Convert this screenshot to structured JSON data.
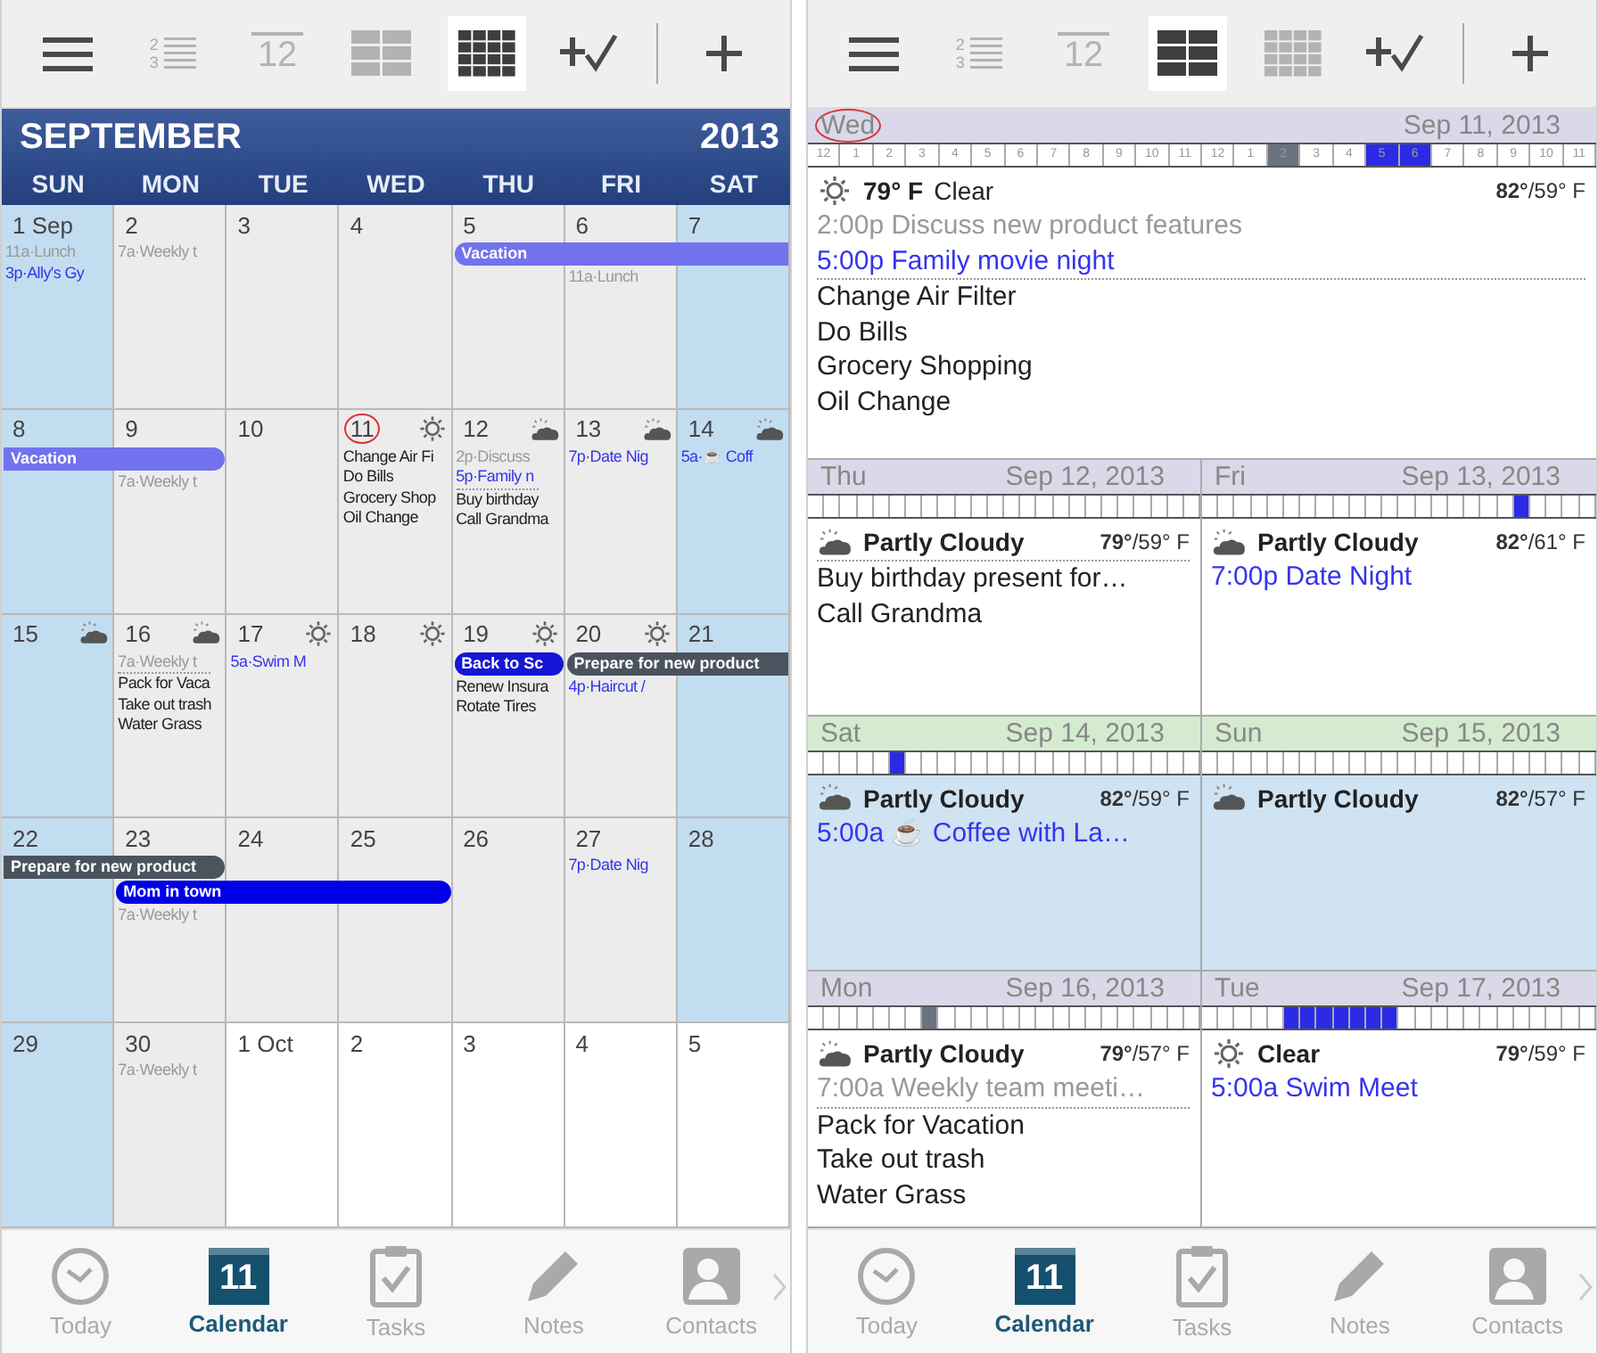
{
  "screens": [
    {
      "kind": "month",
      "toolbar": [
        {
          "kind": "menu",
          "selected": false
        },
        {
          "kind": "list",
          "selected": false,
          "digits": [
            "2",
            "3"
          ]
        },
        {
          "kind": "day",
          "selected": false,
          "text": "12"
        },
        {
          "kind": "week",
          "selected": false
        },
        {
          "kind": "month",
          "selected": true
        },
        {
          "kind": "add_task",
          "selected": false
        },
        {
          "kind": "add",
          "selected": false
        }
      ],
      "month": {
        "title": "SEPTEMBER",
        "year": "2013",
        "weekdays": [
          "SUN",
          "MON",
          "TUE",
          "WED",
          "THU",
          "FRI",
          "SAT"
        ],
        "weeks": [
          {
            "cells": [
              {
                "day": "1 Sep",
                "kind": "weekend",
                "today": false,
                "events": [
                  {
                    "text": "11a·Lunch",
                    "kind": "past"
                  },
                  {
                    "text": "3p·Ally's Gy",
                    "kind": "event"
                  }
                ]
              },
              {
                "day": "2",
                "kind": "weekday",
                "today": false,
                "events": [
                  {
                    "text": "7a·Weekly t",
                    "kind": "past"
                  }
                ]
              },
              {
                "day": "3",
                "kind": "weekday",
                "today": false
              },
              {
                "day": "4",
                "kind": "weekday",
                "today": false
              },
              {
                "day": "5",
                "kind": "weekday",
                "today": false,
                "bars": [
                  {
                    "kind": "start",
                    "label": "Vacation",
                    "color": "#7272ee"
                  }
                ]
              },
              {
                "day": "6",
                "kind": "weekday",
                "today": false,
                "bars": [
                  {
                    "kind": "middle"
                  }
                ],
                "events": [
                  {
                    "text": "11a·Lunch",
                    "kind": "past"
                  }
                ]
              },
              {
                "day": "7",
                "kind": "weekend",
                "today": false,
                "bars": [
                  {
                    "kind": "middle"
                  }
                ]
              }
            ]
          },
          {
            "cells": [
              {
                "day": "8",
                "kind": "weekend",
                "today": false,
                "bars": [
                  {
                    "kind": "continue",
                    "label": "Vacation",
                    "color": "#7272ee"
                  }
                ]
              },
              {
                "day": "9",
                "kind": "weekday",
                "today": false,
                "bars": [
                  {
                    "kind": "end"
                  }
                ],
                "events": [
                  {
                    "text": "7a·Weekly t",
                    "kind": "past"
                  }
                ]
              },
              {
                "day": "10",
                "kind": "weekday",
                "today": false
              },
              {
                "day": "11",
                "kind": "weekday",
                "today": true,
                "weather": {
                  "kind": "sun"
                },
                "events": [
                  {
                    "text": "Change Air Fi",
                    "kind": "task"
                  },
                  {
                    "text": "Do Bills",
                    "kind": "task"
                  },
                  {
                    "text": "Grocery Shop",
                    "kind": "task"
                  },
                  {
                    "text": "Oil Change",
                    "kind": "task"
                  }
                ]
              },
              {
                "day": "12",
                "kind": "weekday",
                "today": false,
                "weather": {
                  "kind": "cloudy"
                },
                "events": [
                  {
                    "text": "2p·Discuss",
                    "kind": "past"
                  },
                  {
                    "text": "5p·Family n",
                    "kind": "event"
                  },
                  {
                    "text": "Buy birthday",
                    "kind": "task"
                  },
                  {
                    "text": "Call Grandma",
                    "kind": "task"
                  }
                ]
              },
              {
                "day": "13",
                "kind": "weekday",
                "today": false,
                "weather": {
                  "kind": "cloudy"
                },
                "events": [
                  {
                    "text": "7p·Date Nig",
                    "kind": "event"
                  }
                ]
              },
              {
                "day": "14",
                "kind": "weekend",
                "today": false,
                "weather": {
                  "kind": "cloudy"
                },
                "events": [
                  {
                    "text": "5a·☕ Coff",
                    "kind": "event"
                  }
                ]
              }
            ]
          },
          {
            "cells": [
              {
                "day": "15",
                "kind": "weekend",
                "today": false,
                "weather": {
                  "kind": "cloudy"
                }
              },
              {
                "day": "16",
                "kind": "weekday",
                "today": false,
                "weather": {
                  "kind": "cloudy"
                },
                "events": [
                  {
                    "text": "7a·Weekly t",
                    "kind": "past"
                  },
                  {
                    "text": "Pack for Vaca",
                    "kind": "task"
                  },
                  {
                    "text": "Take out trash",
                    "kind": "task"
                  },
                  {
                    "text": "Water Grass",
                    "kind": "task"
                  }
                ]
              },
              {
                "day": "17",
                "kind": "weekday",
                "today": false,
                "weather": {
                  "kind": "sun"
                },
                "events": [
                  {
                    "text": "5a·Swim M",
                    "kind": "event"
                  }
                ]
              },
              {
                "day": "18",
                "kind": "weekday",
                "today": false,
                "weather": {
                  "kind": "sun"
                }
              },
              {
                "day": "19",
                "kind": "weekday",
                "today": false,
                "weather": {
                  "kind": "sun"
                },
                "bars": [
                  {
                    "kind": "single",
                    "label": "Back to Sc",
                    "color": "#1616d6"
                  }
                ],
                "events": [
                  {
                    "text": "Renew Insura",
                    "kind": "task"
                  },
                  {
                    "text": "Rotate Tires",
                    "kind": "task"
                  }
                ]
              },
              {
                "day": "20",
                "kind": "weekday",
                "today": false,
                "weather": {
                  "kind": "sun"
                },
                "bars": [
                  {
                    "kind": "start",
                    "label": "Prepare for new product",
                    "color": "#4a535e"
                  }
                ],
                "events": [
                  {
                    "text": "4p·Haircut /",
                    "kind": "event"
                  }
                ]
              },
              {
                "day": "21",
                "kind": "weekend",
                "today": false,
                "bars": [
                  {
                    "kind": "middle"
                  }
                ]
              }
            ]
          },
          {
            "cells": [
              {
                "day": "22",
                "kind": "weekend",
                "today": false,
                "bars": [
                  {
                    "kind": "continue",
                    "label": "Prepare for new product",
                    "color": "#4a535e"
                  }
                ]
              },
              {
                "day": "23",
                "kind": "weekday",
                "today": false,
                "bars": [
                  {
                    "kind": "end"
                  },
                  {
                    "kind": "start",
                    "label": "Mom in town",
                    "color": "#0000e8"
                  }
                ],
                "events": [
                  {
                    "text": "7a·Weekly t",
                    "kind": "past"
                  }
                ]
              },
              {
                "day": "24",
                "kind": "weekday",
                "today": false,
                "bars": [
                  {
                    "kind": "none"
                  },
                  {
                    "kind": "middle"
                  }
                ]
              },
              {
                "day": "25",
                "kind": "weekday",
                "today": false,
                "bars": [
                  {
                    "kind": "none"
                  },
                  {
                    "kind": "end"
                  }
                ]
              },
              {
                "day": "26",
                "kind": "weekday",
                "today": false
              },
              {
                "day": "27",
                "kind": "weekday",
                "today": false,
                "events": [
                  {
                    "text": "7p·Date Nig",
                    "kind": "event"
                  }
                ]
              },
              {
                "day": "28",
                "kind": "weekend",
                "today": false
              }
            ]
          },
          {
            "cells": [
              {
                "day": "29",
                "kind": "weekend",
                "today": false
              },
              {
                "day": "30",
                "kind": "weekday",
                "today": false,
                "events": [
                  {
                    "text": "7a·Weekly t",
                    "kind": "past"
                  }
                ]
              },
              {
                "day": "1 Oct",
                "kind": "next_month",
                "today": false
              },
              {
                "day": "2",
                "kind": "next_month",
                "today": false
              },
              {
                "day": "3",
                "kind": "next_month",
                "today": false
              },
              {
                "day": "4",
                "kind": "next_month",
                "today": false
              },
              {
                "day": "5",
                "kind": "next_month",
                "today": false
              }
            ]
          }
        ]
      },
      "tabbar": [
        {
          "label": "Today",
          "selected": false
        },
        {
          "label": "Calendar",
          "badge": "11",
          "selected": true
        },
        {
          "label": "Tasks",
          "selected": false
        },
        {
          "label": "Notes",
          "selected": false
        },
        {
          "label": "Contacts",
          "selected": false
        }
      ]
    },
    {
      "kind": "days",
      "toolbar": [
        {
          "kind": "menu",
          "selected": false
        },
        {
          "kind": "list",
          "selected": false,
          "digits": [
            "2",
            "3"
          ]
        },
        {
          "kind": "day",
          "selected": false,
          "text": "12"
        },
        {
          "kind": "week",
          "selected": true
        },
        {
          "kind": "month",
          "selected": false
        },
        {
          "kind": "add_task",
          "selected": false
        },
        {
          "kind": "add",
          "selected": false
        }
      ],
      "days": {
        "top": {
          "weekday": "Wed",
          "date": "Sep 11, 2013",
          "weekend": false,
          "today": true,
          "slots": [
            {
              "label": "12",
              "kind": "free"
            },
            {
              "label": "1",
              "kind": "free"
            },
            {
              "label": "2",
              "kind": "free"
            },
            {
              "label": "3",
              "kind": "free"
            },
            {
              "label": "4",
              "kind": "free"
            },
            {
              "label": "5",
              "kind": "free"
            },
            {
              "label": "6",
              "kind": "free"
            },
            {
              "label": "7",
              "kind": "free"
            },
            {
              "label": "8",
              "kind": "free"
            },
            {
              "label": "9",
              "kind": "free"
            },
            {
              "label": "10",
              "kind": "free"
            },
            {
              "label": "11",
              "kind": "free"
            },
            {
              "label": "12",
              "kind": "free"
            },
            {
              "label": "1",
              "kind": "free"
            },
            {
              "label": "2",
              "kind": "past"
            },
            {
              "label": "3",
              "kind": "free"
            },
            {
              "label": "4",
              "kind": "free"
            },
            {
              "label": "5",
              "kind": "busy"
            },
            {
              "label": "6",
              "kind": "busy"
            },
            {
              "label": "7",
              "kind": "free"
            },
            {
              "label": "8",
              "kind": "free"
            },
            {
              "label": "9",
              "kind": "free"
            },
            {
              "label": "10",
              "kind": "free"
            },
            {
              "label": "11",
              "kind": "free"
            }
          ],
          "weather": {
            "kind": "sun",
            "temp": "79° F",
            "condition": "Clear",
            "range": "**82°**/59° F"
          },
          "items": [
            {
              "text": "2:00p Discuss new product features",
              "kind": "past"
            },
            {
              "text": "5:00p Family movie night",
              "kind": "event"
            },
            {
              "text": "Change Air Filter",
              "kind": "task"
            },
            {
              "text": "Do Bills",
              "kind": "task"
            },
            {
              "text": "Grocery Shopping",
              "kind": "task"
            },
            {
              "text": "Oil Change",
              "kind": "task"
            }
          ]
        },
        "grid": [
          {
            "weekday": "Thu",
            "date": "Sep 12, 2013",
            "weekend": false,
            "today": false,
            "slots": [
              {
                "kind": "free"
              },
              {
                "kind": "free"
              },
              {
                "kind": "free"
              },
              {
                "kind": "free"
              },
              {
                "kind": "free"
              },
              {
                "kind": "free"
              },
              {
                "kind": "free"
              },
              {
                "kind": "free"
              },
              {
                "kind": "free"
              },
              {
                "kind": "free"
              },
              {
                "kind": "free"
              },
              {
                "kind": "free"
              },
              {
                "kind": "free"
              },
              {
                "kind": "free"
              },
              {
                "kind": "free"
              },
              {
                "kind": "free"
              },
              {
                "kind": "free"
              },
              {
                "kind": "free"
              },
              {
                "kind": "free"
              },
              {
                "kind": "free"
              },
              {
                "kind": "free"
              },
              {
                "kind": "free"
              },
              {
                "kind": "free"
              },
              {
                "kind": "free"
              }
            ],
            "weather": {
              "kind": "cloudy",
              "condition": "Partly Cloudy",
              "range": "**79°**/59° F"
            },
            "items": [
              {
                "text": "Buy birthday present for…",
                "kind": "task"
              },
              {
                "text": "Call Grandma",
                "kind": "task"
              }
            ]
          },
          {
            "weekday": "Fri",
            "date": "Sep 13, 2013",
            "weekend": false,
            "today": false,
            "slots": [
              {
                "kind": "free"
              },
              {
                "kind": "free"
              },
              {
                "kind": "free"
              },
              {
                "kind": "free"
              },
              {
                "kind": "free"
              },
              {
                "kind": "free"
              },
              {
                "kind": "free"
              },
              {
                "kind": "free"
              },
              {
                "kind": "free"
              },
              {
                "kind": "free"
              },
              {
                "kind": "free"
              },
              {
                "kind": "free"
              },
              {
                "kind": "free"
              },
              {
                "kind": "free"
              },
              {
                "kind": "free"
              },
              {
                "kind": "free"
              },
              {
                "kind": "free"
              },
              {
                "kind": "free"
              },
              {
                "kind": "free"
              },
              {
                "kind": "busy"
              },
              {
                "kind": "free"
              },
              {
                "kind": "free"
              },
              {
                "kind": "free"
              },
              {
                "kind": "free"
              }
            ],
            "weather": {
              "kind": "cloudy",
              "condition": "Partly Cloudy",
              "range": "**82°**/61° F"
            },
            "items": [
              {
                "text": "7:00p Date Night",
                "kind": "event"
              }
            ]
          },
          {
            "weekday": "Sat",
            "date": "Sep 14, 2013",
            "weekend": true,
            "today": false,
            "slots": [
              {
                "kind": "free"
              },
              {
                "kind": "free"
              },
              {
                "kind": "free"
              },
              {
                "kind": "free"
              },
              {
                "kind": "free"
              },
              {
                "kind": "busy"
              },
              {
                "kind": "free"
              },
              {
                "kind": "free"
              },
              {
                "kind": "free"
              },
              {
                "kind": "free"
              },
              {
                "kind": "free"
              },
              {
                "kind": "free"
              },
              {
                "kind": "free"
              },
              {
                "kind": "free"
              },
              {
                "kind": "free"
              },
              {
                "kind": "free"
              },
              {
                "kind": "free"
              },
              {
                "kind": "free"
              },
              {
                "kind": "free"
              },
              {
                "kind": "free"
              },
              {
                "kind": "free"
              },
              {
                "kind": "free"
              },
              {
                "kind": "free"
              },
              {
                "kind": "free"
              }
            ],
            "weather": {
              "kind": "cloudy",
              "condition": "Partly Cloudy",
              "range": "**82°**/59° F"
            },
            "items": [
              {
                "text": "5:00a ☕ Coffee with La…",
                "kind": "event"
              }
            ]
          },
          {
            "weekday": "Sun",
            "date": "Sep 15, 2013",
            "weekend": true,
            "today": false,
            "slots": [
              {
                "kind": "free"
              },
              {
                "kind": "free"
              },
              {
                "kind": "free"
              },
              {
                "kind": "free"
              },
              {
                "kind": "free"
              },
              {
                "kind": "free"
              },
              {
                "kind": "free"
              },
              {
                "kind": "free"
              },
              {
                "kind": "free"
              },
              {
                "kind": "free"
              },
              {
                "kind": "free"
              },
              {
                "kind": "free"
              },
              {
                "kind": "free"
              },
              {
                "kind": "free"
              },
              {
                "kind": "free"
              },
              {
                "kind": "free"
              },
              {
                "kind": "free"
              },
              {
                "kind": "free"
              },
              {
                "kind": "free"
              },
              {
                "kind": "free"
              },
              {
                "kind": "free"
              },
              {
                "kind": "free"
              },
              {
                "kind": "free"
              },
              {
                "kind": "free"
              }
            ],
            "weather": {
              "kind": "cloudy",
              "condition": "Partly Cloudy",
              "range": "**82°**/57° F"
            }
          },
          {
            "weekday": "Mon",
            "date": "Sep 16, 2013",
            "weekend": false,
            "today": false,
            "slots": [
              {
                "kind": "free"
              },
              {
                "kind": "free"
              },
              {
                "kind": "free"
              },
              {
                "kind": "free"
              },
              {
                "kind": "free"
              },
              {
                "kind": "free"
              },
              {
                "kind": "free"
              },
              {
                "kind": "past"
              },
              {
                "kind": "free"
              },
              {
                "kind": "free"
              },
              {
                "kind": "free"
              },
              {
                "kind": "free"
              },
              {
                "kind": "free"
              },
              {
                "kind": "free"
              },
              {
                "kind": "free"
              },
              {
                "kind": "free"
              },
              {
                "kind": "free"
              },
              {
                "kind": "free"
              },
              {
                "kind": "free"
              },
              {
                "kind": "free"
              },
              {
                "kind": "free"
              },
              {
                "kind": "free"
              },
              {
                "kind": "free"
              },
              {
                "kind": "free"
              }
            ],
            "weather": {
              "kind": "cloudy",
              "condition": "Partly Cloudy",
              "range": "**79°**/57° F"
            },
            "items": [
              {
                "text": "7:00a Weekly team meeti…",
                "kind": "past"
              },
              {
                "text": "Pack for Vacation",
                "kind": "task"
              },
              {
                "text": "Take out trash",
                "kind": "task"
              },
              {
                "text": "Water Grass",
                "kind": "task"
              }
            ]
          },
          {
            "weekday": "Tue",
            "date": "Sep 17, 2013",
            "weekend": false,
            "today": false,
            "slots": [
              {
                "kind": "free"
              },
              {
                "kind": "free"
              },
              {
                "kind": "free"
              },
              {
                "kind": "free"
              },
              {
                "kind": "free"
              },
              {
                "kind": "busy"
              },
              {
                "kind": "busy"
              },
              {
                "kind": "busy"
              },
              {
                "kind": "busy"
              },
              {
                "kind": "busy"
              },
              {
                "kind": "busy"
              },
              {
                "kind": "busy"
              },
              {
                "kind": "free"
              },
              {
                "kind": "free"
              },
              {
                "kind": "free"
              },
              {
                "kind": "free"
              },
              {
                "kind": "free"
              },
              {
                "kind": "free"
              },
              {
                "kind": "free"
              },
              {
                "kind": "free"
              },
              {
                "kind": "free"
              },
              {
                "kind": "free"
              },
              {
                "kind": "free"
              },
              {
                "kind": "free"
              }
            ],
            "weather": {
              "kind": "sun",
              "condition": "Clear",
              "range": "**79°**/59° F"
            },
            "items": [
              {
                "text": "5:00a Swim Meet",
                "kind": "event"
              }
            ]
          }
        ]
      },
      "tabbar": [
        {
          "label": "Today",
          "selected": false
        },
        {
          "label": "Calendar",
          "badge": "11",
          "selected": true
        },
        {
          "label": "Tasks",
          "selected": false
        },
        {
          "label": "Notes",
          "selected": false
        },
        {
          "label": "Contacts",
          "selected": false
        }
      ]
    }
  ]
}
